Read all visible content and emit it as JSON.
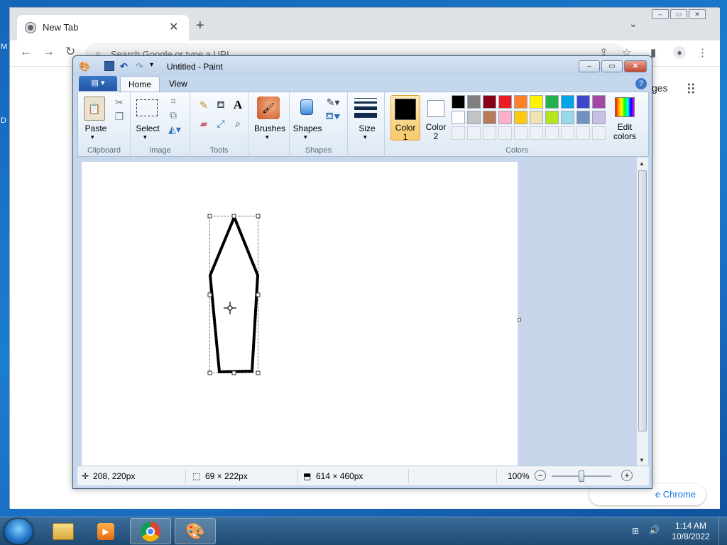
{
  "chrome": {
    "tab_title": "New Tab",
    "tab_close": "✕",
    "new_tab": "+",
    "tab_search": "⌄",
    "omnibox_placeholder": "Search Google or type a URL",
    "images_link": "ges",
    "customize": "e Chrome",
    "window_buttons": [
      "–",
      "▭",
      "✕"
    ]
  },
  "paint": {
    "title": "Untitled - Paint",
    "tabs": [
      "Home",
      "View"
    ],
    "help": "?",
    "groups": {
      "clipboard": {
        "label": "Clipboard",
        "paste": "Paste"
      },
      "image": {
        "label": "Image",
        "select": "Select"
      },
      "tools": {
        "label": "Tools"
      },
      "brushes": {
        "label": "Brushes"
      },
      "shapes": {
        "label": "Shapes",
        "shapes": "Shapes"
      },
      "size": {
        "label": "Size"
      },
      "colors": {
        "label": "Colors",
        "color1": "Color\n1",
        "color1_a": "Color",
        "color1_b": "1",
        "color2_a": "Color",
        "color2_b": "2",
        "edit_a": "Edit",
        "edit_b": "colors",
        "color1_value": "#000000",
        "color2_value": "#ffffff",
        "palette_row1": [
          "#000000",
          "#7f7f7f",
          "#880015",
          "#ed1c24",
          "#ff7f27",
          "#fff200",
          "#22b14c",
          "#00a2e8",
          "#3f48cc",
          "#a349a4"
        ],
        "palette_row2": [
          "#ffffff",
          "#c3c3c3",
          "#b97a57",
          "#ffaec9",
          "#ffc90e",
          "#efe4b0",
          "#b5e61d",
          "#99d9ea",
          "#7092be",
          "#c8bfe7"
        ]
      }
    },
    "status": {
      "cursor_pos": "208, 220px",
      "selection_size": "69 × 222px",
      "canvas_size": "614 × 460px",
      "zoom": "100%",
      "zoom_level": 0.5
    }
  },
  "taskbar": {
    "time": "1:14 AM",
    "date": "10/8/2022"
  }
}
